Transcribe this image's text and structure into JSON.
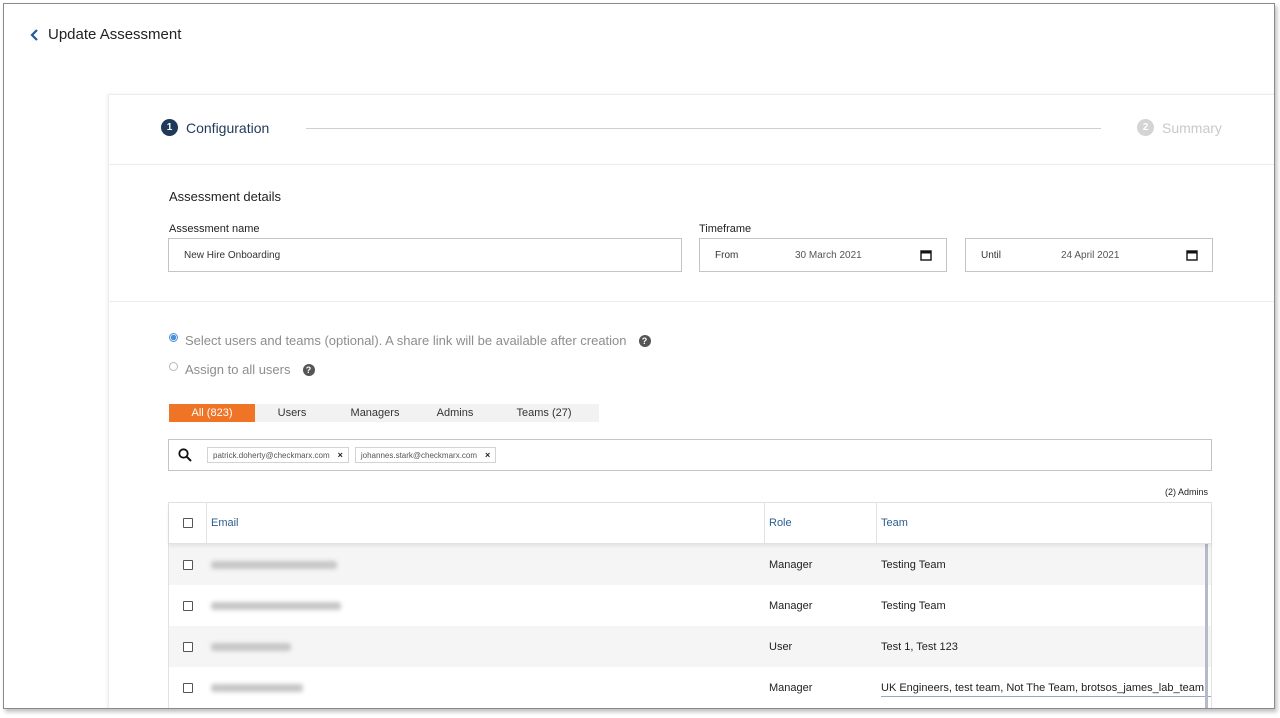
{
  "header": {
    "title": "Update Assessment"
  },
  "stepper": {
    "steps": [
      {
        "number": "1",
        "label": "Configuration"
      },
      {
        "number": "2",
        "label": "Summary"
      }
    ]
  },
  "details": {
    "section_title": "Assessment details",
    "name_label": "Assessment name",
    "name_value": "New Hire Onboarding",
    "timeframe_label": "Timeframe",
    "from_prefix": "From",
    "from_value": "30 March 2021",
    "until_prefix": "Until",
    "until_value": "24 April 2021"
  },
  "assignment": {
    "option_select": "Select users and teams (optional). A share link will be available after creation",
    "option_all": "Assign to all users",
    "help_glyph": "?"
  },
  "filter_tabs": [
    {
      "label": "All (823)"
    },
    {
      "label": "Users"
    },
    {
      "label": "Managers"
    },
    {
      "label": "Admins"
    },
    {
      "label": "Teams (27)"
    }
  ],
  "search": {
    "chips": [
      {
        "label": "patrick.doherty@checkmarx.com"
      },
      {
        "label": "johannes.stark@checkmarx.com"
      }
    ],
    "remove_glyph": "×"
  },
  "selection_count": "(2) Admins",
  "table": {
    "headers": {
      "email": "Email",
      "role": "Role",
      "team": "Team"
    },
    "rows": [
      {
        "role": "Manager",
        "team": "Testing Team"
      },
      {
        "role": "Manager",
        "team": "Testing Team"
      },
      {
        "role": "User",
        "team": "Test 1, Test 123"
      },
      {
        "role": "Manager",
        "team": "UK Engineers, test team, Not The Team, brotsos_james_lab_team, Fragalli"
      }
    ]
  },
  "colors": {
    "primary": "#1f3a5a",
    "accent_tab": "#f07426",
    "link_header": "#2c5d8f",
    "radio_selected": "#4a90d9"
  },
  "icons": [
    "chevron-left-icon",
    "calendar-icon",
    "help-icon",
    "search-icon",
    "close-icon",
    "checkbox-icon"
  ]
}
